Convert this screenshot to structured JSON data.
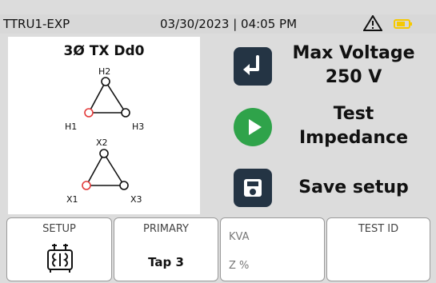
{
  "status": {
    "device": "TTRU1-EXP",
    "datetime": "03/30/2023 | 04:05 PM",
    "warning_icon": "warning-icon",
    "battery_icon": "battery-icon",
    "battery_color": "#f6c900"
  },
  "transformer": {
    "title": "3Ø TX Dd0",
    "primary_top": "H2",
    "primary_left": "H1",
    "primary_right": "H3",
    "secondary_top": "X2",
    "secondary_left": "X1",
    "secondary_right": "X3"
  },
  "actions": [
    {
      "label_line1": "Max Voltage",
      "label_line2": "250 V",
      "icon": "enter-icon"
    },
    {
      "label_line1": "Test",
      "label_line2": "Impedance",
      "icon": "play-icon"
    },
    {
      "label_line1": "Save setup",
      "icon": "save-icon"
    }
  ],
  "tabs": {
    "setup": {
      "title": "SETUP",
      "icon": "transformer-icon"
    },
    "primary": {
      "title": "PRIMARY",
      "value": "Tap 3"
    },
    "rating": {
      "kva": "KVA",
      "zpct": "Z %"
    },
    "test_id": {
      "title": "TEST ID"
    }
  },
  "colors": {
    "accent_dark": "#243444",
    "accent_green": "#2fa34a",
    "terminal_red": "#e33a3a"
  }
}
